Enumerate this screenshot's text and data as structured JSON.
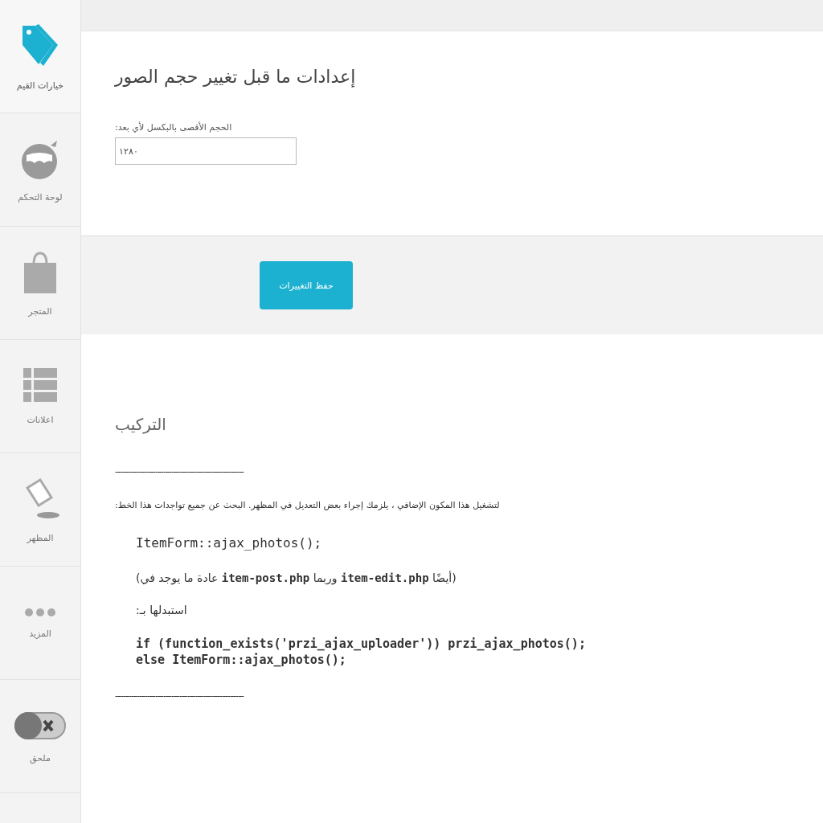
{
  "sidebar": {
    "items": [
      {
        "label": "خيارات القيم",
        "selected": true
      },
      {
        "label": "لوحة التحكم",
        "selected": false
      },
      {
        "label": "المتجر",
        "selected": false
      },
      {
        "label": "اعلانات",
        "selected": false
      },
      {
        "label": "المظهر",
        "selected": false
      },
      {
        "label": "المزيد",
        "selected": false
      },
      {
        "label": "ملحق",
        "selected": false
      }
    ]
  },
  "settings": {
    "title": "إعدادات ما قبل تغيير حجم الصور",
    "field_label": "الحجم الأقصى بالبكسل لأي بعد:",
    "field_value": "١٢٨٠",
    "save_button": "حفظ التغييرات"
  },
  "install": {
    "title": "التركيب",
    "separator_top": "------------------------------------------------",
    "intro": "لتشغيل هذا المكون الإضافي ، يلزمك إجراء بعض التعديل في المظهر. البحث عن جميع تواجدات هذا الخط:",
    "blocks": [
      {
        "kind": "code",
        "lines": [
          "ItemForm::ajax_photos();"
        ]
      },
      {
        "kind": "note",
        "text": "(أيضًا **item-edit.php** وربما **item-post.php** عادة ما يوجد في)"
      },
      {
        "kind": "note",
        "text": "استبدلها بـ:"
      },
      {
        "kind": "strongcode",
        "lines": [
          "if (function_exists('przi_ajax_uploader')) przi_ajax_photos();",
          "else ItemForm::ajax_photos();"
        ]
      }
    ],
    "separator_bottom": "------------------------------------------------"
  }
}
